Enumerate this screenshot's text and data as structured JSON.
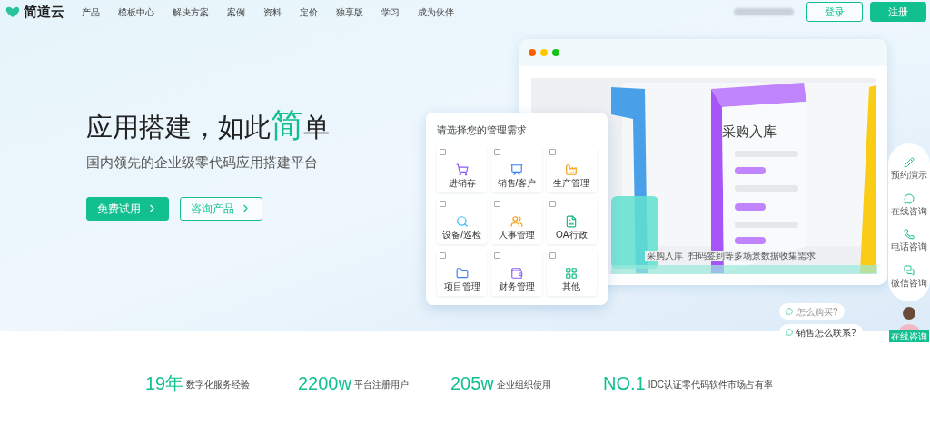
{
  "header": {
    "brand": "简道云",
    "nav": [
      {
        "label": "产品"
      },
      {
        "label": "模板中心"
      },
      {
        "label": "解决方案"
      },
      {
        "label": "案例"
      },
      {
        "label": "资料"
      },
      {
        "label": "定价"
      },
      {
        "label": "独享版"
      },
      {
        "label": "学习"
      },
      {
        "label": "成为伙伴"
      }
    ],
    "buttons": [
      {
        "label": "登录",
        "kind": "outline"
      },
      {
        "label": "注册",
        "kind": "solid"
      }
    ]
  },
  "hero": {
    "title_parts": [
      {
        "text": "应用搭建，如此",
        "highlight": false
      },
      {
        "text": "简",
        "highlight": true
      },
      {
        "text": "单",
        "highlight": false
      }
    ],
    "subtitle": "国内领先的企业级零代码应用搭建平台",
    "buttons": [
      {
        "label": "免费试用",
        "kind": "solid"
      },
      {
        "label": "咨询产品",
        "kind": "outline"
      }
    ]
  },
  "needs_card": {
    "title": "请选择您的管理需求",
    "options": [
      {
        "label": "进销存",
        "checked": false
      },
      {
        "label": "销售/客户",
        "checked": false
      },
      {
        "label": "生产管理",
        "checked": false
      },
      {
        "label": "设备/巡检",
        "checked": false
      },
      {
        "label": "人事管理",
        "checked": false
      },
      {
        "label": "OA行政",
        "checked": false
      },
      {
        "label": "项目管理",
        "checked": false
      },
      {
        "label": "财务管理",
        "checked": false
      },
      {
        "label": "其他",
        "checked": false
      }
    ]
  },
  "mockup": {
    "doc_title": "采购入库",
    "caption": "采购入库  扫码签到等多场景数据收集需求"
  },
  "side_tools": [
    {
      "label": "预约演示"
    },
    {
      "label": "在线咨询"
    },
    {
      "label": "电话咨询"
    },
    {
      "label": "微信咨询"
    }
  ],
  "chat_prompts": [
    {
      "text": "怎么购买?"
    },
    {
      "text": "销售怎么联系?"
    }
  ],
  "agent_badge": "在线咨询",
  "stats": [
    {
      "value": "19年",
      "label": "数字化服务经验"
    },
    {
      "value": "2200w",
      "label": "平台注册用户"
    },
    {
      "value": "205w",
      "label": "企业组织使用"
    },
    {
      "value": "NO.1",
      "label": "IDC认证零代码软件市场占有率"
    }
  ]
}
